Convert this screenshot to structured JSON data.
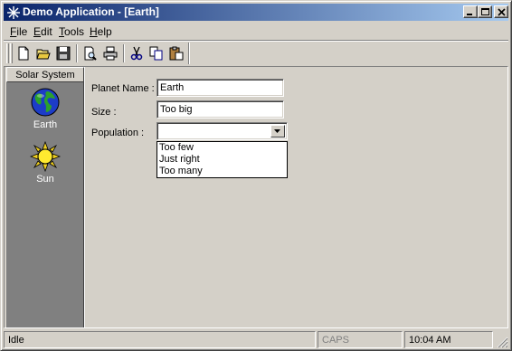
{
  "window": {
    "title": "Demo Application - [Earth]"
  },
  "menu": [
    {
      "label": "File",
      "accel": "F",
      "rest": "ile"
    },
    {
      "label": "Edit",
      "accel": "E",
      "rest": "dit"
    },
    {
      "label": "Tools",
      "accel": "T",
      "rest": "ools"
    },
    {
      "label": "Help",
      "accel": "H",
      "rest": "elp"
    }
  ],
  "toolbar": [
    "new-document-icon",
    "open-folder-icon",
    "save-disk-icon",
    "print-preview-icon",
    "print-icon",
    "cut-icon",
    "copy-icon",
    "paste-icon"
  ],
  "sidebar": {
    "header": "Solar System",
    "items": [
      {
        "label": "Earth",
        "icon": "earth-globe-icon"
      },
      {
        "label": "Sun",
        "icon": "sun-icon"
      }
    ]
  },
  "form": {
    "planet_name_label": "Planet Name :",
    "planet_name_value": "Earth",
    "size_label": "Size :",
    "size_value": "Too big",
    "population_label": "Population :",
    "population_value": "",
    "population_options": [
      "Too few",
      "Just right",
      "Too many"
    ]
  },
  "status": {
    "message": "Idle",
    "caps": "CAPS",
    "time": "10:04 AM"
  },
  "colors": {
    "titlebar_start": "#0a246a",
    "titlebar_end": "#a6caf0",
    "face": "#d4d0c8",
    "sidebar": "#808080"
  }
}
